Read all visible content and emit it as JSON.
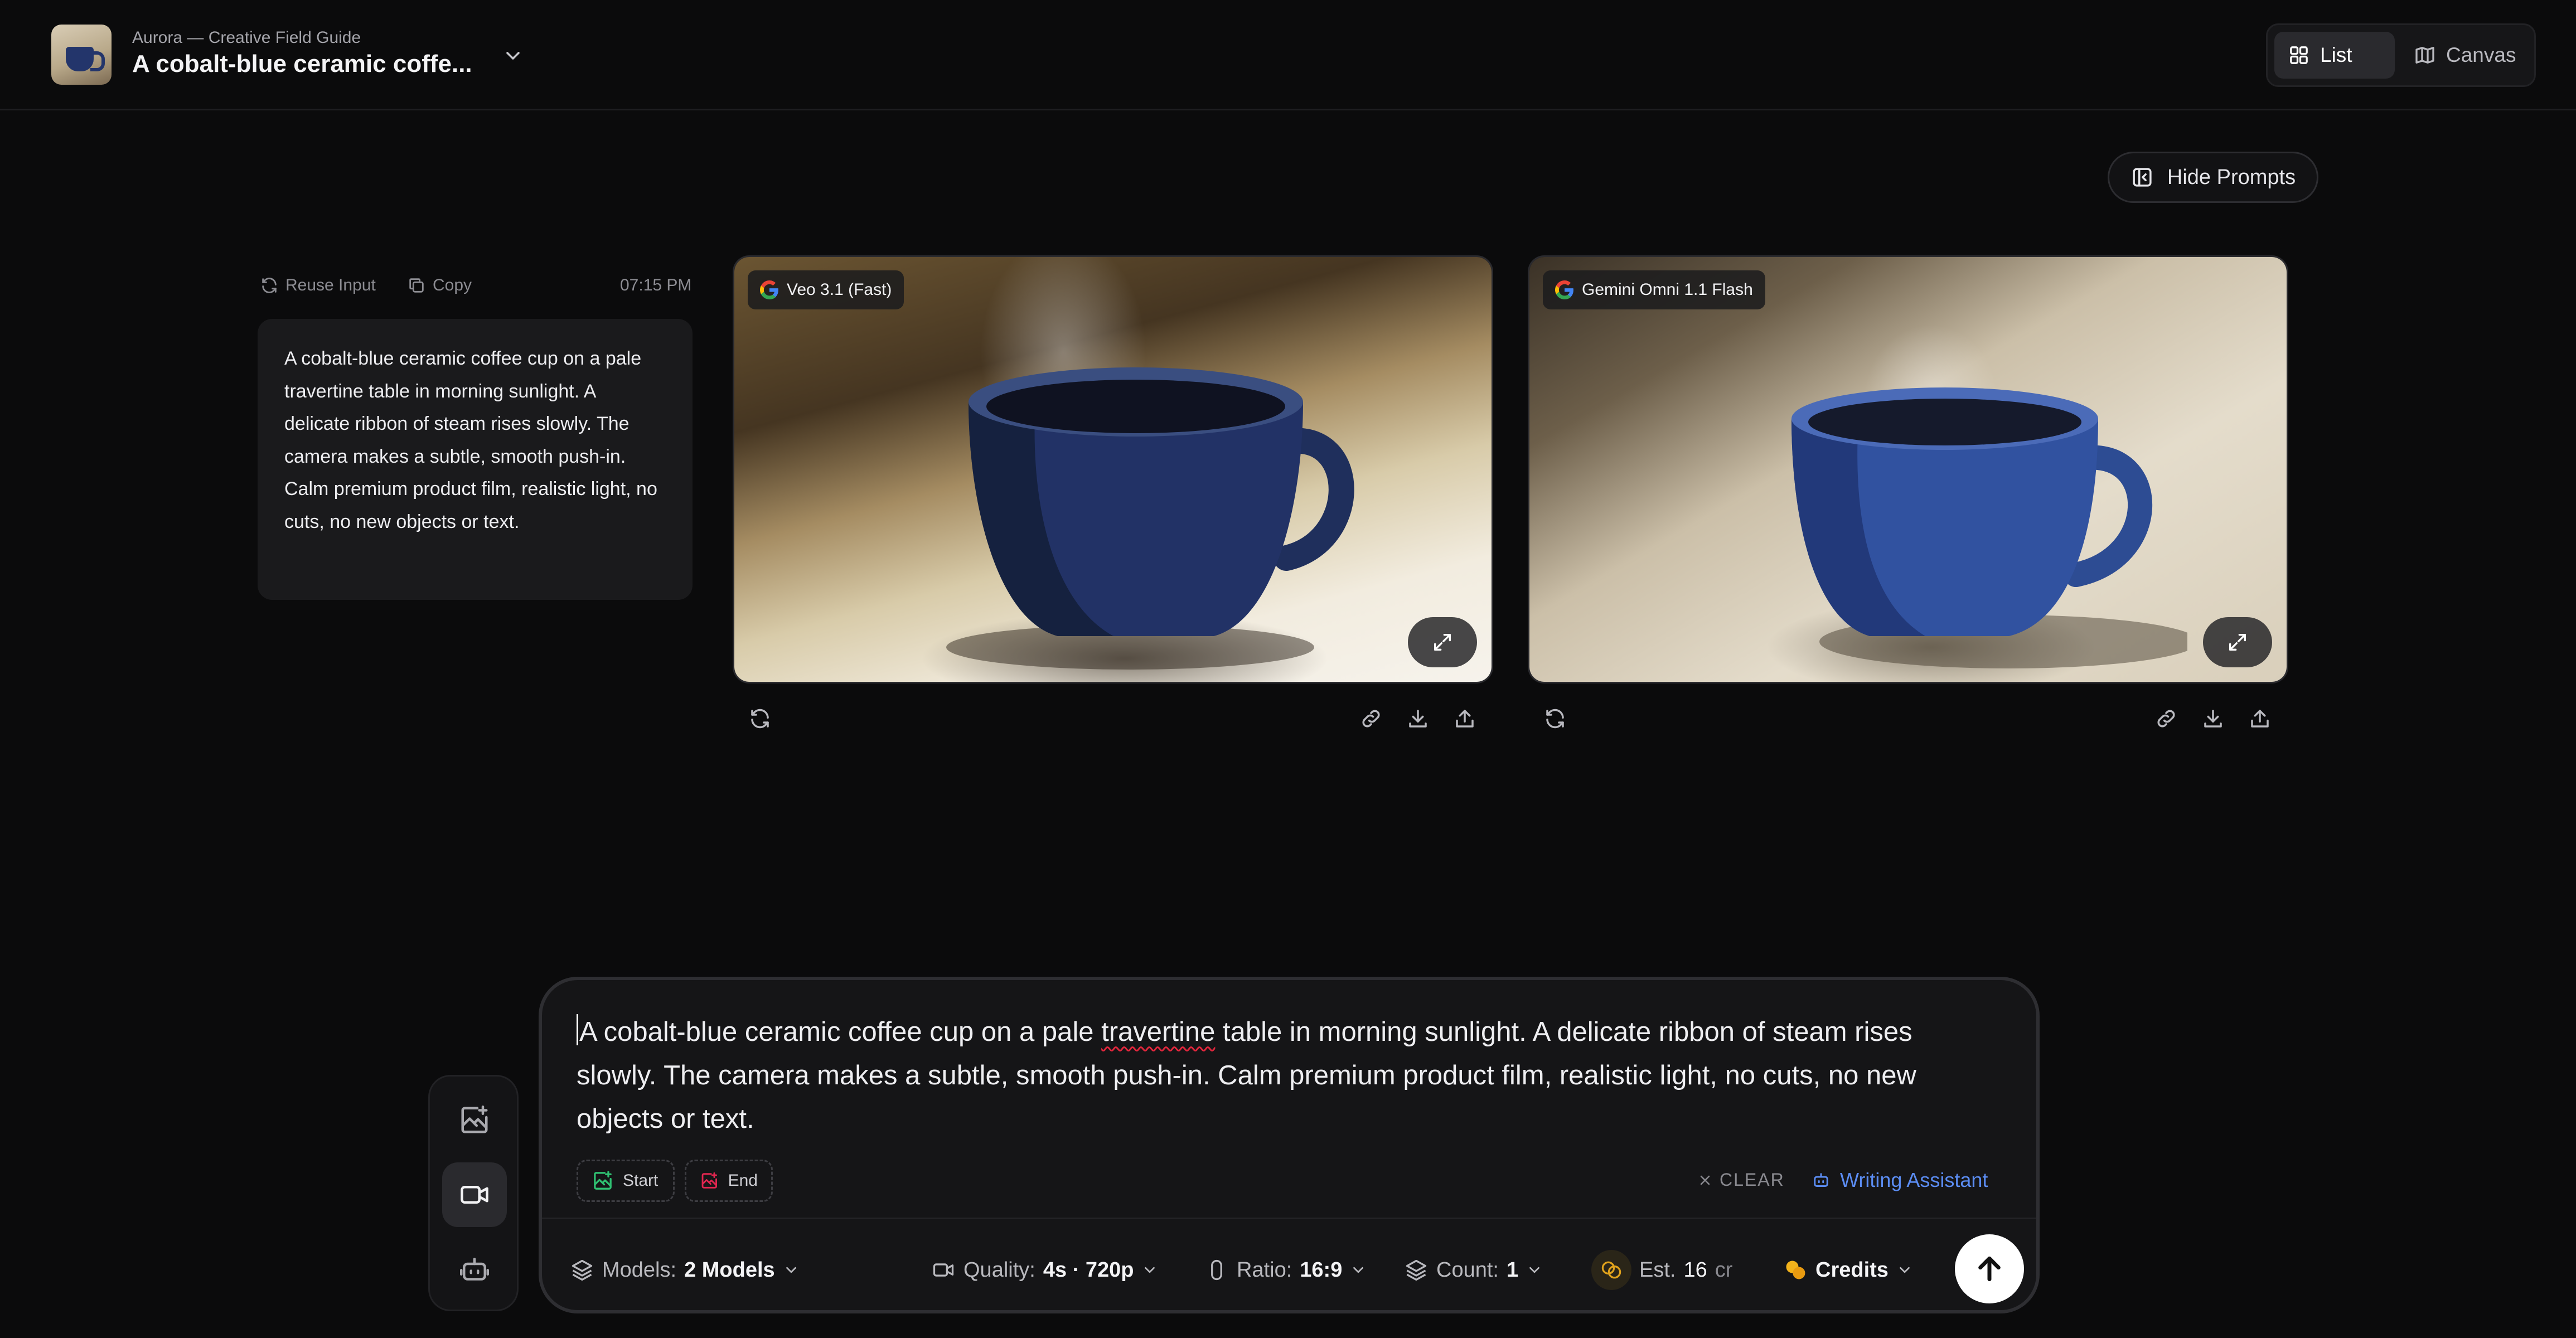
{
  "header": {
    "subtitle": "Aurora — Creative Field Guide",
    "title": "A cobalt-blue ceramic coffe...",
    "view_list": "List",
    "view_canvas": "Canvas"
  },
  "hide_prompts": "Hide Prompts",
  "prompt_panel": {
    "reuse": "Reuse Input",
    "copy": "Copy",
    "time": "07:15 PM",
    "text": "A cobalt-blue ceramic coffee cup on a pale travertine table in morning sunlight. A delicate ribbon of steam rises slowly. The camera makes a subtle, smooth push-in. Calm premium product film, realistic light, no cuts, no new objects or text."
  },
  "results": [
    {
      "model": "Veo 3.1 (Fast)"
    },
    {
      "model": "Gemini Omni 1.1 Flash"
    }
  ],
  "composer": {
    "text_part1": "A cobalt-blue ceramic coffee cup on a pale ",
    "text_misspelled": "travertine",
    "text_part2": " table in morning sunlight. A delicate ribbon of steam rises slowly. The camera makes a subtle, smooth push-in. Calm premium product film, realistic light, no cuts, no new objects or text.",
    "start_label": "Start",
    "end_label": "End",
    "clear_label": "CLEAR",
    "writing_assistant": "Writing Assistant",
    "models_label": "Models:",
    "models_value": "2 Models",
    "quality_label": "Quality:",
    "quality_value": "4s · 720p",
    "ratio_label": "Ratio:",
    "ratio_value": "16:9",
    "count_label": "Count:",
    "count_value": "1",
    "est_label": "Est.",
    "est_value": "16",
    "est_unit": "cr",
    "credits_label": "Credits"
  },
  "colors": {
    "background": "#0b0b0c",
    "accent_blue": "#5b8cf2",
    "start_green": "#2fbf71",
    "end_red": "#e0264f",
    "coin_yellow": "#f2b21b"
  }
}
